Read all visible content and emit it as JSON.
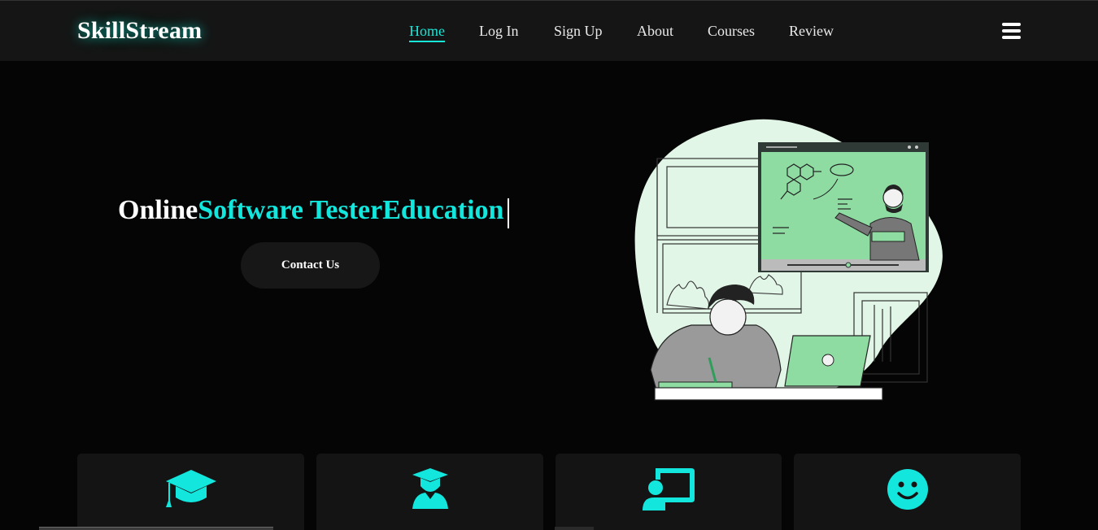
{
  "header": {
    "logo": "SkillStream",
    "nav": [
      "Home",
      "Log In",
      "Sign Up",
      "About",
      "Courses",
      "Review"
    ],
    "active_nav": "Home",
    "menu_icon": "hamburger-menu-icon"
  },
  "hero": {
    "title_prefix": "Online",
    "title_highlight": "Software Tester",
    "title_suffix": "Education",
    "button_label": "Contact Us"
  },
  "features": {
    "icons": [
      "graduation-cap-icon",
      "graduate-student-icon",
      "online-teacher-icon",
      "smile-face-icon"
    ]
  },
  "colors": {
    "accent": "#12e6dd",
    "background": "#050505",
    "header_bg": "#151515",
    "card_bg": "#141414",
    "illustration_green": "#8fdca3"
  }
}
